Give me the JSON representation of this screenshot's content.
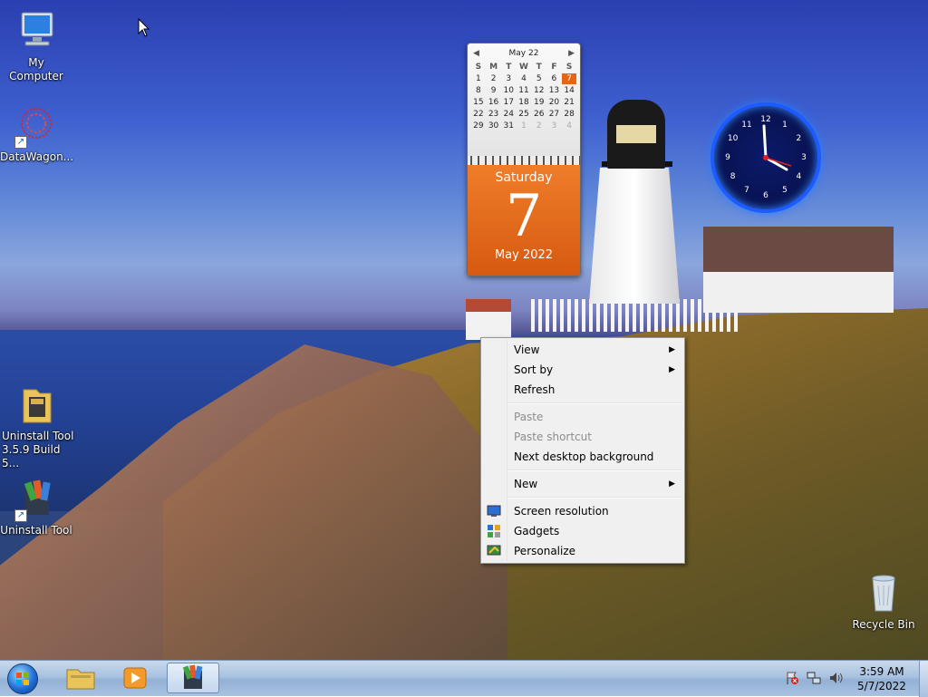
{
  "desktop": {
    "icons": [
      {
        "label": "My Computer",
        "icon": "computer-icon"
      },
      {
        "label": "DataWagon...",
        "icon": "datawagon-icon"
      },
      {
        "label": "Uninstall Tool 3.5.9 Build 5...",
        "icon": "folder-icon"
      },
      {
        "label": "Uninstall Tool",
        "icon": "uninstall-tool-icon"
      },
      {
        "label": "Recycle Bin",
        "icon": "recycle-bin-icon"
      }
    ]
  },
  "calendar": {
    "month_year_header": "May 22",
    "weekdays": [
      "S",
      "M",
      "T",
      "W",
      "T",
      "F",
      "S"
    ],
    "weeks": [
      [
        "1",
        "2",
        "3",
        "4",
        "5",
        "6",
        "7"
      ],
      [
        "8",
        "9",
        "10",
        "11",
        "12",
        "13",
        "14"
      ],
      [
        "15",
        "16",
        "17",
        "18",
        "19",
        "20",
        "21"
      ],
      [
        "22",
        "23",
        "24",
        "25",
        "26",
        "27",
        "28"
      ],
      [
        "29",
        "30",
        "31",
        "1",
        "2",
        "3",
        "4"
      ]
    ],
    "today": "7",
    "weekday_name": "Saturday",
    "day_number": "7",
    "month_year": "May 2022"
  },
  "clock": {
    "numerals": [
      "12",
      "1",
      "2",
      "3",
      "4",
      "5",
      "6",
      "7",
      "8",
      "9",
      "10",
      "11"
    ]
  },
  "context_menu": {
    "items": [
      {
        "label": "View",
        "submenu": true,
        "disabled": false
      },
      {
        "label": "Sort by",
        "submenu": true,
        "disabled": false
      },
      {
        "label": "Refresh",
        "submenu": false,
        "disabled": false
      },
      {
        "label": "Paste",
        "submenu": false,
        "disabled": true
      },
      {
        "label": "Paste shortcut",
        "submenu": false,
        "disabled": true
      },
      {
        "label": "Next desktop background",
        "submenu": false,
        "disabled": false
      },
      {
        "label": "New",
        "submenu": true,
        "disabled": false
      },
      {
        "label": "Screen resolution",
        "submenu": false,
        "disabled": false,
        "icon": "screen-resolution-icon"
      },
      {
        "label": "Gadgets",
        "submenu": false,
        "disabled": false,
        "icon": "gadgets-icon"
      },
      {
        "label": "Personalize",
        "submenu": false,
        "disabled": false,
        "icon": "personalize-icon"
      }
    ]
  },
  "taskbar": {
    "start_icon": "windows-start-orb",
    "pinned": [
      {
        "icon": "windows-explorer-icon"
      },
      {
        "icon": "media-player-icon"
      },
      {
        "icon": "uninstall-tool-icon",
        "active": true
      }
    ],
    "tray": [
      {
        "icon": "action-center-flag-icon"
      },
      {
        "icon": "network-icon"
      },
      {
        "icon": "volume-icon"
      }
    ],
    "time": "3:59 AM",
    "date": "5/7/2022"
  },
  "colors": {
    "calendar_accent": "#e5661b",
    "clock_ring": "#1c5bff",
    "menu_bg": "#f0f0f0"
  }
}
